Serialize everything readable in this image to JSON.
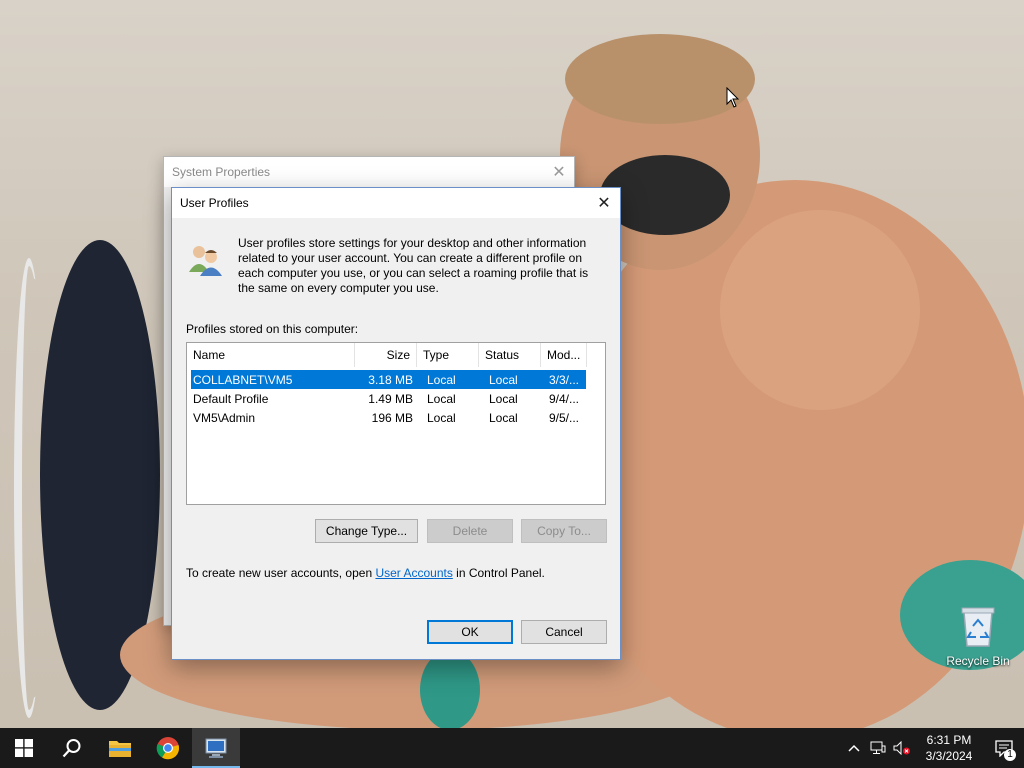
{
  "background_dialog": {
    "title": "System Properties"
  },
  "dialog": {
    "title": "User Profiles",
    "description": "User profiles store settings for your desktop and other information related to your user account. You can create a different profile on each computer you use, or you can select a roaming profile that is the same on every computer you use.",
    "profiles_label": "Profiles stored on this computer:",
    "columns": [
      "Name",
      "Size",
      "Type",
      "Status",
      "Mod..."
    ],
    "rows": [
      {
        "name": "COLLABNET\\VM5",
        "size": "3.18 MB",
        "type": "Local",
        "status": "Local",
        "modified": "3/3/...",
        "selected": true
      },
      {
        "name": "Default Profile",
        "size": "1.49 MB",
        "type": "Local",
        "status": "Local",
        "modified": "9/4/...",
        "selected": false
      },
      {
        "name": "VM5\\Admin",
        "size": "196 MB",
        "type": "Local",
        "status": "Local",
        "modified": "9/5/...",
        "selected": false
      }
    ],
    "buttons": {
      "change_type": "Change Type...",
      "delete": "Delete",
      "copy_to": "Copy To...",
      "ok": "OK",
      "cancel": "Cancel"
    },
    "footer": {
      "prefix": "To create new user accounts, open ",
      "link": "User Accounts",
      "suffix": " in Control Panel."
    }
  },
  "desktop": {
    "recycle_bin_label": "Recycle Bin"
  },
  "taskbar": {
    "time": "6:31 PM",
    "date": "3/3/2024",
    "notification_count": "1",
    "apps": [
      "start-icon",
      "search-icon",
      "file-explorer-icon",
      "chrome-icon",
      "system-properties-icon"
    ]
  },
  "colors": {
    "selection": "#0078d7",
    "link": "#0066cc",
    "taskbar": "#1a1a1a"
  }
}
